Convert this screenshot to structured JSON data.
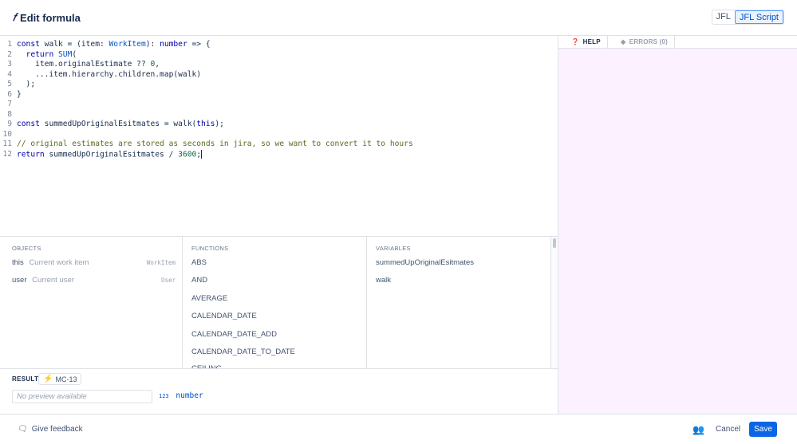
{
  "header": {
    "title": "Edit formula",
    "title_icon": "formula-icon",
    "modes": [
      "JFL",
      "JFL Script"
    ],
    "active_mode": "JFL Script"
  },
  "editor": {
    "lines": [
      {
        "n": "1",
        "tokens": [
          {
            "t": "kw",
            "v": "const"
          },
          {
            "t": "pl",
            "v": " walk = (item: "
          },
          {
            "t": "ty",
            "v": "WorkItem"
          },
          {
            "t": "pl",
            "v": "): "
          },
          {
            "t": "kw",
            "v": "number"
          },
          {
            "t": "pl",
            "v": " => {"
          }
        ]
      },
      {
        "n": "2",
        "tokens": [
          {
            "t": "pl",
            "v": "  "
          },
          {
            "t": "kw",
            "v": "return"
          },
          {
            "t": "pl",
            "v": " "
          },
          {
            "t": "ty",
            "v": "SUM"
          },
          {
            "t": "pl",
            "v": "("
          }
        ]
      },
      {
        "n": "3",
        "tokens": [
          {
            "t": "pl",
            "v": "    item.originalEstimate ?? "
          },
          {
            "t": "num",
            "v": "0"
          },
          {
            "t": "pl",
            "v": ","
          }
        ]
      },
      {
        "n": "4",
        "tokens": [
          {
            "t": "pl",
            "v": "    ...item.hierarchy.children.map(walk)"
          }
        ]
      },
      {
        "n": "5",
        "tokens": [
          {
            "t": "pl",
            "v": "  );"
          }
        ]
      },
      {
        "n": "6",
        "tokens": [
          {
            "t": "pl",
            "v": "}"
          }
        ]
      },
      {
        "n": "7",
        "tokens": []
      },
      {
        "n": "8",
        "tokens": []
      },
      {
        "n": "9",
        "tokens": [
          {
            "t": "kw",
            "v": "const"
          },
          {
            "t": "pl",
            "v": " summedUpOriginalEsitmates = walk("
          },
          {
            "t": "kw",
            "v": "this"
          },
          {
            "t": "pl",
            "v": ");"
          }
        ]
      },
      {
        "n": "10",
        "tokens": []
      },
      {
        "n": "11",
        "tokens": [
          {
            "t": "cm",
            "v": "// original estimates are stored as seconds in jira, so we want to convert it to hours"
          }
        ]
      },
      {
        "n": "12",
        "tokens": [
          {
            "t": "kw",
            "v": "return"
          },
          {
            "t": "pl",
            "v": " summedUpOriginalEsitmates / "
          },
          {
            "t": "num",
            "v": "3600"
          },
          {
            "t": "pl",
            "v": ";"
          }
        ]
      }
    ]
  },
  "right_panel": {
    "tabs": [
      {
        "label": "HELP",
        "icon": "help-icon",
        "glyph": "❓"
      },
      {
        "label": "ERRORS (0)",
        "icon": "error-diamond-icon",
        "glyph": "◆"
      }
    ]
  },
  "helper": {
    "objects": {
      "heading": "OBJECTS",
      "items": [
        {
          "key": "this",
          "desc": "Current work item",
          "type": "WorkItem"
        },
        {
          "key": "user",
          "desc": "Current user",
          "type": "User"
        }
      ]
    },
    "functions": {
      "heading": "FUNCTIONS",
      "items": [
        "ABS",
        "AND",
        "AVERAGE",
        "CALENDAR_DATE",
        "CALENDAR_DATE_ADD",
        "CALENDAR_DATE_TO_DATE",
        "CEILING"
      ]
    },
    "variables": {
      "heading": "VARIABLES",
      "items": [
        "summedUpOriginalEsitmates",
        "walk"
      ]
    }
  },
  "result": {
    "label": "RESULT",
    "issue_key": "MC-13",
    "preview_placeholder": "No preview available",
    "type_label": "number",
    "type_glyph": "123"
  },
  "footer": {
    "feedback_label": "Give feedback",
    "cancel_label": "Cancel",
    "save_label": "Save"
  },
  "colors": {
    "accent": "#0c66e4",
    "help_panel_bg": "#fcf2ff",
    "keyword": "#0000aa",
    "comment": "#546e1f"
  }
}
